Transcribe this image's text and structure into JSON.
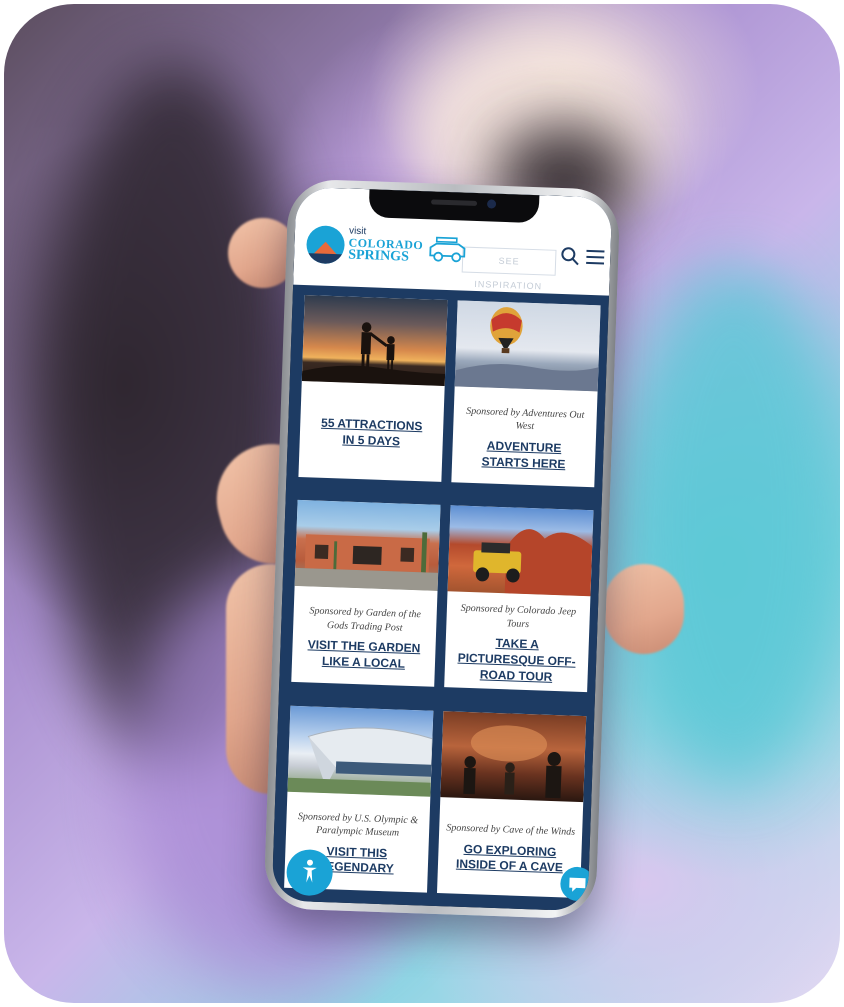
{
  "site": {
    "logo": {
      "visit": "visit",
      "colorado": "COLORADO",
      "springs": "SPRINGS"
    },
    "header_button": "SEE INSPIRATION",
    "icons": [
      "jeep-icon",
      "search-icon",
      "menu-icon",
      "accessibility-icon",
      "chat-icon"
    ]
  },
  "cards": [
    {
      "sponsor": "",
      "title_line1": "55 ATTRACTIONS",
      "title_line2": "IN 5 DAYS"
    },
    {
      "sponsor": "Sponsored by Adventures Out West",
      "title_line1": "ADVENTURE",
      "title_line2": "STARTS HERE"
    },
    {
      "sponsor": "Sponsored by Garden of the Gods Trading Post",
      "title_line1": "VISIT THE GARDEN",
      "title_line2": "LIKE A LOCAL"
    },
    {
      "sponsor": "Sponsored by Colorado Jeep Tours",
      "title_line1": "TAKE A",
      "title_line2": "PICTURESQUE OFF-ROAD TOUR"
    },
    {
      "sponsor": "Sponsored by U.S. Olympic & Paralympic Museum",
      "title_line1": "VISIT THIS",
      "title_line2": "LEGENDARY"
    },
    {
      "sponsor": "Sponsored by Cave of the Winds",
      "title_line1": "GO EXPLORING",
      "title_line2": "INSIDE OF A CAVE"
    }
  ],
  "colors": {
    "navy": "#1d3b63",
    "accent": "#1aa3d6"
  }
}
